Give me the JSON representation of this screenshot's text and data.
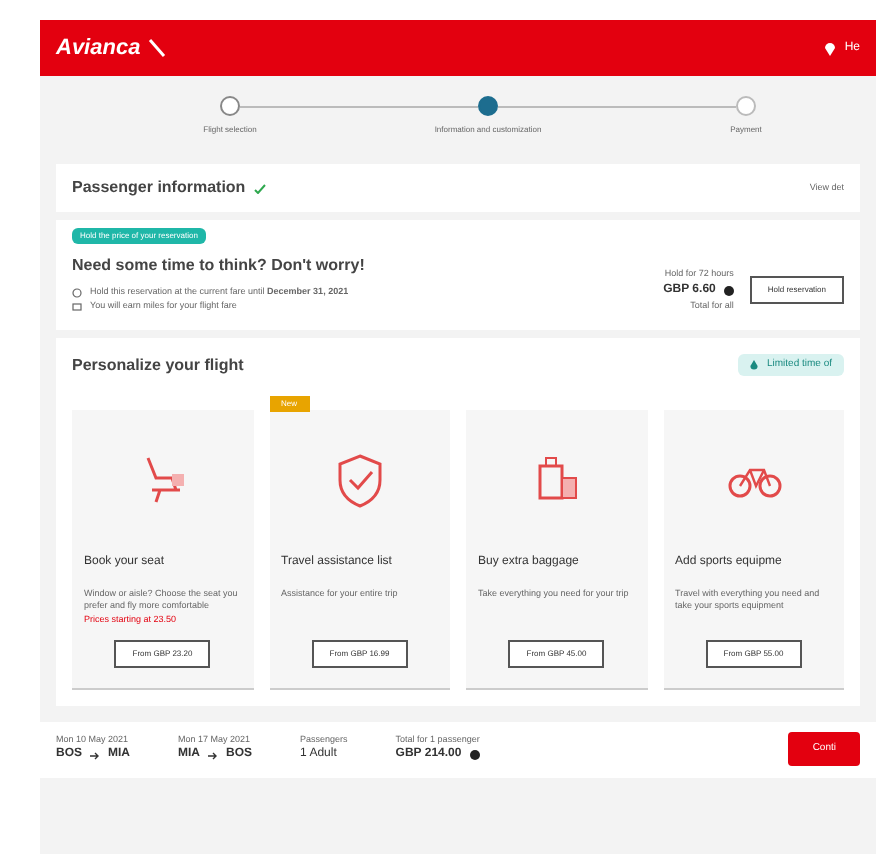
{
  "header": {
    "logo": "Avianca",
    "right_text": "He"
  },
  "steps": [
    {
      "label": "Flight selection",
      "done": true,
      "selected": false
    },
    {
      "label": "Information and customization",
      "done": false,
      "selected": true
    },
    {
      "label": "Payment",
      "done": false,
      "selected": false
    }
  ],
  "passenger": {
    "title": "Passenger information",
    "link": "View det"
  },
  "hold": {
    "badge": "Hold the price of your reservation",
    "title": "Need some time to think? Don't worry!",
    "lines": [
      "Hold this reservation at the current fare until **December 31, 2021**",
      "You will earn miles for your flight fare"
    ],
    "price_label": "Hold for 72 hours",
    "price": "GBP 6.60",
    "price_note": "Total for all",
    "button": "Hold reservation"
  },
  "personalize": {
    "title": "Personalize your flight",
    "badge": "Limited time of",
    "cards": [
      {
        "kind": "seat",
        "title": "Book your seat",
        "text": "Window or aisle? Choose the seat you prefer and fly more comfortable",
        "note": "Prices starting at 23.50",
        "button": "From GBP 23.20"
      },
      {
        "kind": "shield",
        "title": "Travel assistance list",
        "tag": "New",
        "text": "Assistance for your entire trip",
        "button": "From GBP 16.99"
      },
      {
        "kind": "baggage",
        "title": "Buy extra baggage",
        "text": "Take everything you need for your trip",
        "button": "From GBP 45.00"
      },
      {
        "kind": "bike",
        "title": "Add sports equipme",
        "text": "Travel with everything you need and take your sports equipment",
        "button": "From GBP 55.00"
      }
    ]
  },
  "summary": {
    "legs": [
      {
        "date": "Mon 10 May 2021",
        "from": "BOS",
        "to": "MIA"
      },
      {
        "date": "Mon 17 May 2021",
        "from": "MIA",
        "to": "BOS"
      }
    ],
    "passengers_label": "Passengers",
    "passengers": "1 Adult",
    "total_label": "Total for 1 passenger",
    "total": "GBP 214.00",
    "button": "Conti"
  }
}
